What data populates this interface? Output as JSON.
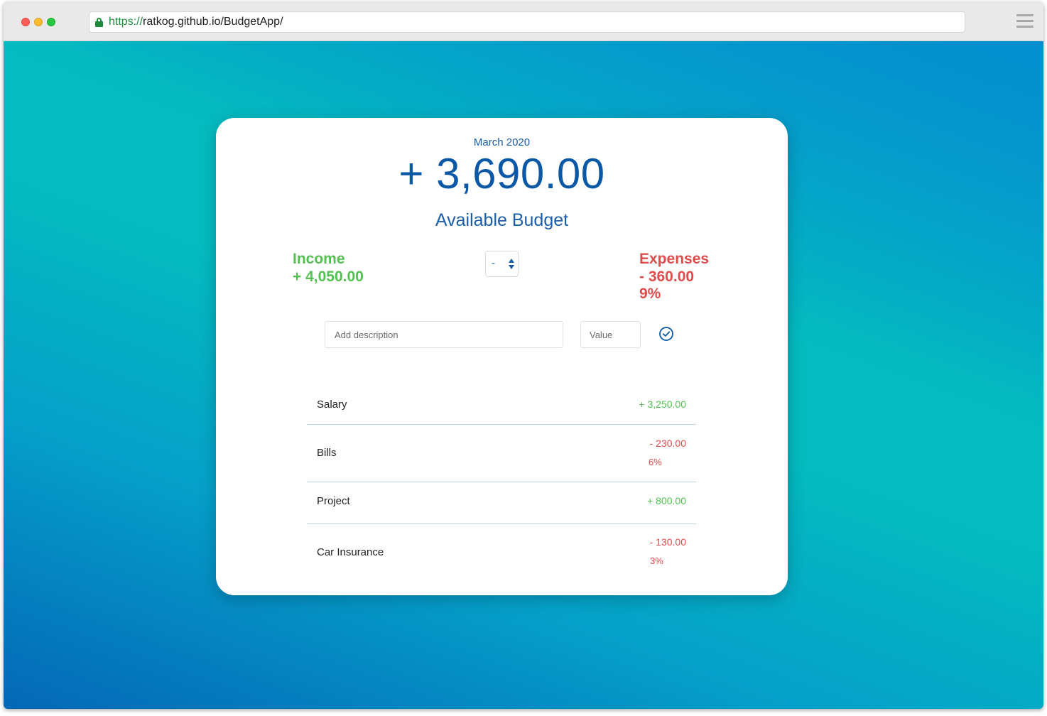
{
  "browser": {
    "url_scheme": "https://",
    "url_rest": "ratkog.github.io/BudgetApp/"
  },
  "budget": {
    "month": "March 2020",
    "available_value": "+ 3,690.00",
    "available_label": "Available Budget"
  },
  "summary": {
    "income_label": "Income",
    "income_value": "+ 4,050.00",
    "expenses_label": "Expenses",
    "expenses_value": "- 360.00",
    "expenses_percent": "9%"
  },
  "form": {
    "type_selected": "-",
    "description_placeholder": "Add description",
    "value_placeholder": "Value"
  },
  "transactions": [
    {
      "name": "Salary",
      "amount": "+ 3,250.00",
      "type": "income"
    },
    {
      "name": "Bills",
      "amount": "- 230.00",
      "percent": "6%",
      "type": "expense"
    },
    {
      "name": "Project",
      "amount": "+ 800.00",
      "type": "income"
    },
    {
      "name": "Car Insurance",
      "amount": "- 130.00",
      "percent": "3%",
      "type": "expense"
    }
  ],
  "colors": {
    "income": "#53c052",
    "expense": "#de4c4c",
    "primary": "#0a58a6"
  },
  "icons": {
    "add": "check-circle-icon",
    "lock": "lock-icon",
    "menu": "menu-icon"
  }
}
